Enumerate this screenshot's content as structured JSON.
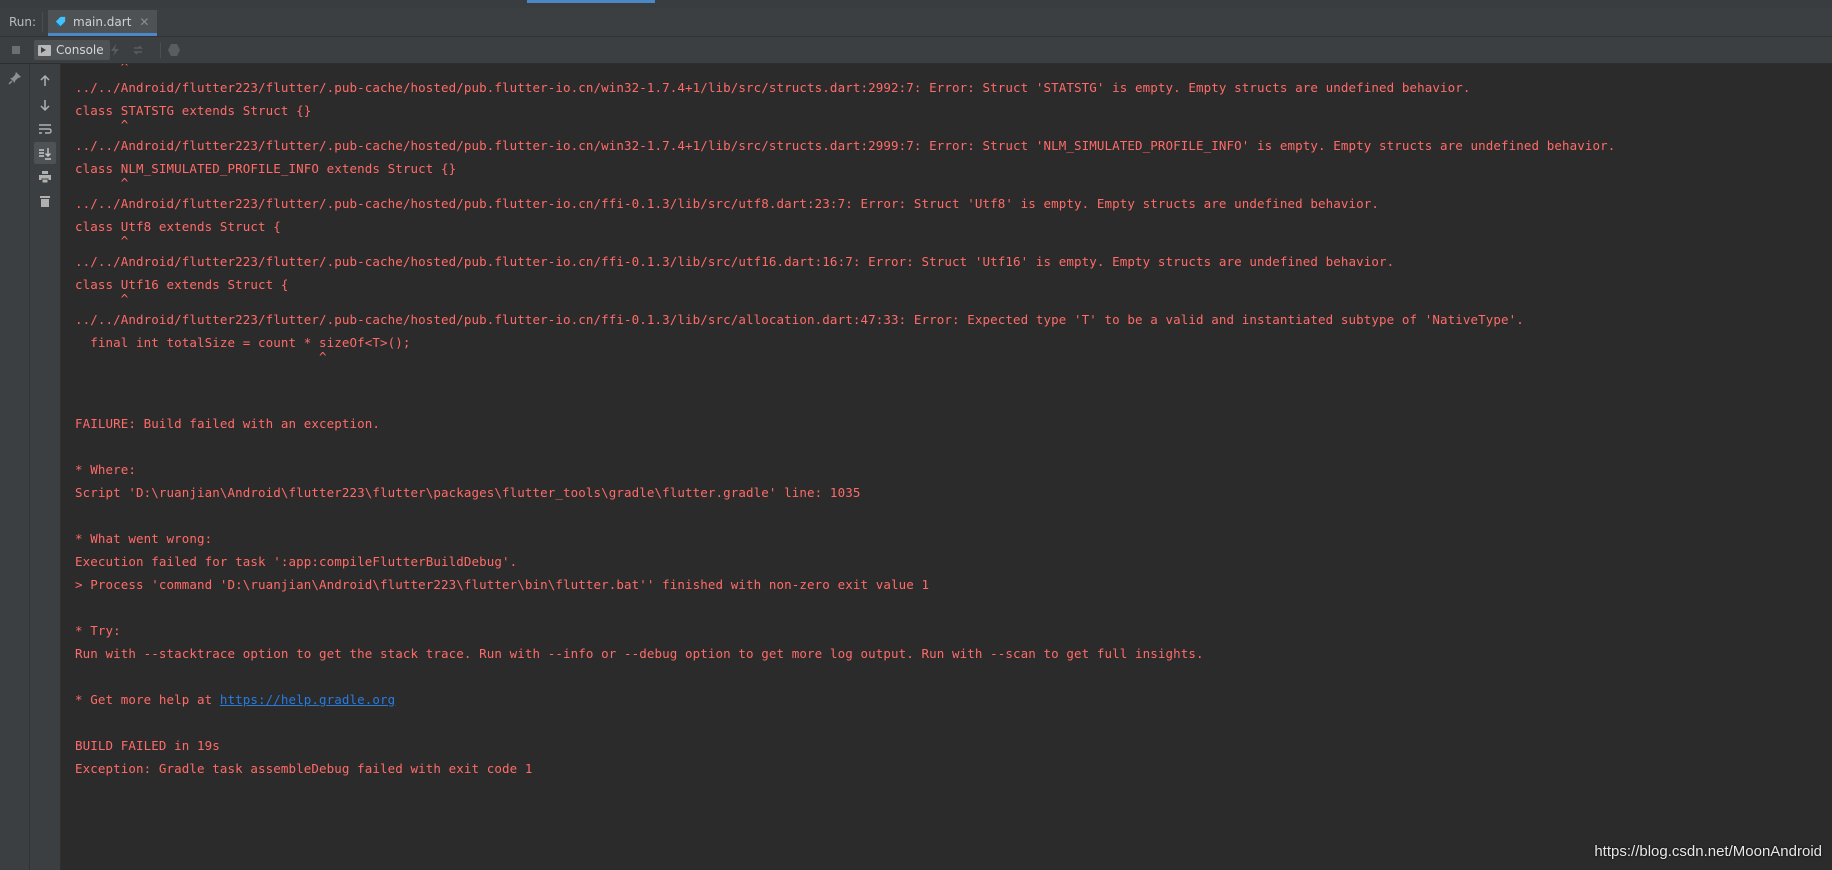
{
  "run_bar": {
    "label": "Run:",
    "tab_label": "main.dart",
    "close_glyph": "✕"
  },
  "toolbar": {
    "console_label": "Console",
    "icons": [
      "stop-icon",
      "console-icon",
      "lightning-icon",
      "rerun-icon",
      "settings-hex-icon"
    ]
  },
  "side_toolbar": {
    "icons": [
      "pin-icon",
      "up-arrow-icon",
      "down-arrow-icon",
      "soft-wrap-icon",
      "scroll-to-end-icon",
      "print-icon",
      "trash-icon"
    ]
  },
  "colors": {
    "error_text": "#ff6b68",
    "link": "#287bde",
    "background": "#2b2b2b",
    "accent": "#4a88c7"
  },
  "console": {
    "lines": [
      "      ^",
      "../../Android/flutter223/flutter/.pub-cache/hosted/pub.flutter-io.cn/win32-1.7.4+1/lib/src/structs.dart:2992:7: Error: Struct 'STATSTG' is empty. Empty structs are undefined behavior.",
      "class STATSTG extends Struct {}",
      "      ^",
      "../../Android/flutter223/flutter/.pub-cache/hosted/pub.flutter-io.cn/win32-1.7.4+1/lib/src/structs.dart:2999:7: Error: Struct 'NLM_SIMULATED_PROFILE_INFO' is empty. Empty structs are undefined behavior.",
      "class NLM_SIMULATED_PROFILE_INFO extends Struct {}",
      "      ^",
      "../../Android/flutter223/flutter/.pub-cache/hosted/pub.flutter-io.cn/ffi-0.1.3/lib/src/utf8.dart:23:7: Error: Struct 'Utf8' is empty. Empty structs are undefined behavior.",
      "class Utf8 extends Struct {",
      "      ^",
      "../../Android/flutter223/flutter/.pub-cache/hosted/pub.flutter-io.cn/ffi-0.1.3/lib/src/utf16.dart:16:7: Error: Struct 'Utf16' is empty. Empty structs are undefined behavior.",
      "class Utf16 extends Struct {",
      "      ^",
      "../../Android/flutter223/flutter/.pub-cache/hosted/pub.flutter-io.cn/ffi-0.1.3/lib/src/allocation.dart:47:33: Error: Expected type 'T' to be a valid and instantiated subtype of 'NativeType'.",
      "  final int totalSize = count * sizeOf<T>();",
      "                                ^",
      "",
      "",
      "FAILURE: Build failed with an exception.",
      "",
      "* Where:",
      "Script 'D:\\ruanjian\\Android\\flutter223\\flutter\\packages\\flutter_tools\\gradle\\flutter.gradle' line: 1035",
      "",
      "* What went wrong:",
      "Execution failed for task ':app:compileFlutterBuildDebug'.",
      "> Process 'command 'D:\\ruanjian\\Android\\flutter223\\flutter\\bin\\flutter.bat'' finished with non-zero exit value 1",
      "",
      "* Try:",
      "Run with --stacktrace option to get the stack trace. Run with --info or --debug option to get more log output. Run with --scan to get full insights.",
      "",
      "* Get more help at ",
      "",
      "BUILD FAILED in 19s",
      "Exception: Gradle task assembleDebug failed with exit code 1"
    ],
    "help_link": "https://help.gradle.org"
  },
  "watermark": "https://blog.csdn.net/MoonAndroid"
}
